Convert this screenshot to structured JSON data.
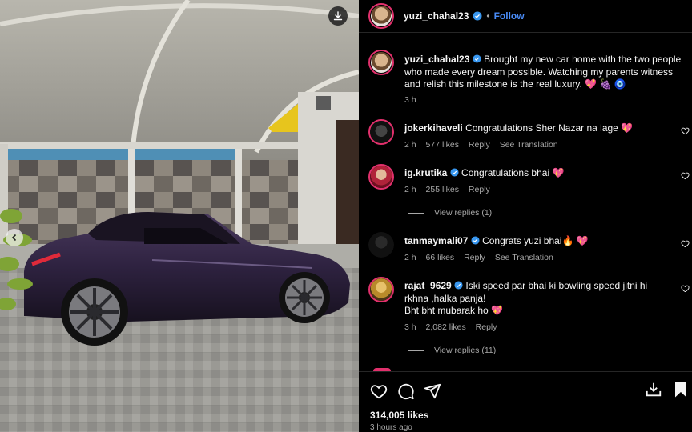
{
  "post": {
    "author": "yuzi_chahal23",
    "follow_label": "Follow",
    "caption": "Brought my new car home with the two people who made every dream possible. Watching my parents witness and relish this milestone is the real luxury. 💖 🍇 🧿",
    "caption_time": "3 h",
    "likes": "314,005 likes",
    "posted_ago": "3 hours ago"
  },
  "comments": [
    {
      "user": "jokerkihaveli",
      "verified": false,
      "text": "Congratulations Sher Nazar na lage 💖",
      "time": "2 h",
      "likes": "577 likes",
      "reply": "Reply",
      "translate": "See Translation"
    },
    {
      "user": "ig.krutika",
      "verified": true,
      "text": "Congratulations bhai 💖",
      "time": "2 h",
      "likes": "255 likes",
      "reply": "Reply",
      "view_replies": "View replies (1)"
    },
    {
      "user": "tanmaymali07",
      "verified": true,
      "text": "Congrats yuzi bhai🔥 💖",
      "time": "2 h",
      "likes": "66 likes",
      "reply": "Reply",
      "translate": "See Translation"
    },
    {
      "user": "rajat_9629",
      "verified": true,
      "text": "Iski speed par bhai ki bowling speed jitni hi rkhna ,halka panja!",
      "text2": "Bht bht mubarak ho 💖",
      "time": "3 h",
      "likes": "2,082 likes",
      "reply": "Reply",
      "view_replies": "View replies (11)"
    }
  ],
  "icons": {
    "download": "download-icon",
    "prev": "chevron-left-icon",
    "like": "heart-icon",
    "comment": "comment-icon",
    "share": "send-icon",
    "save_to_device": "download-tray-icon",
    "bookmark": "bookmark-icon",
    "verified": "verified-badge-icon"
  },
  "colors": {
    "accent": "#4a8cf7",
    "verified": "#3897f0",
    "background": "#000000",
    "muted": "#a8a8a8"
  }
}
